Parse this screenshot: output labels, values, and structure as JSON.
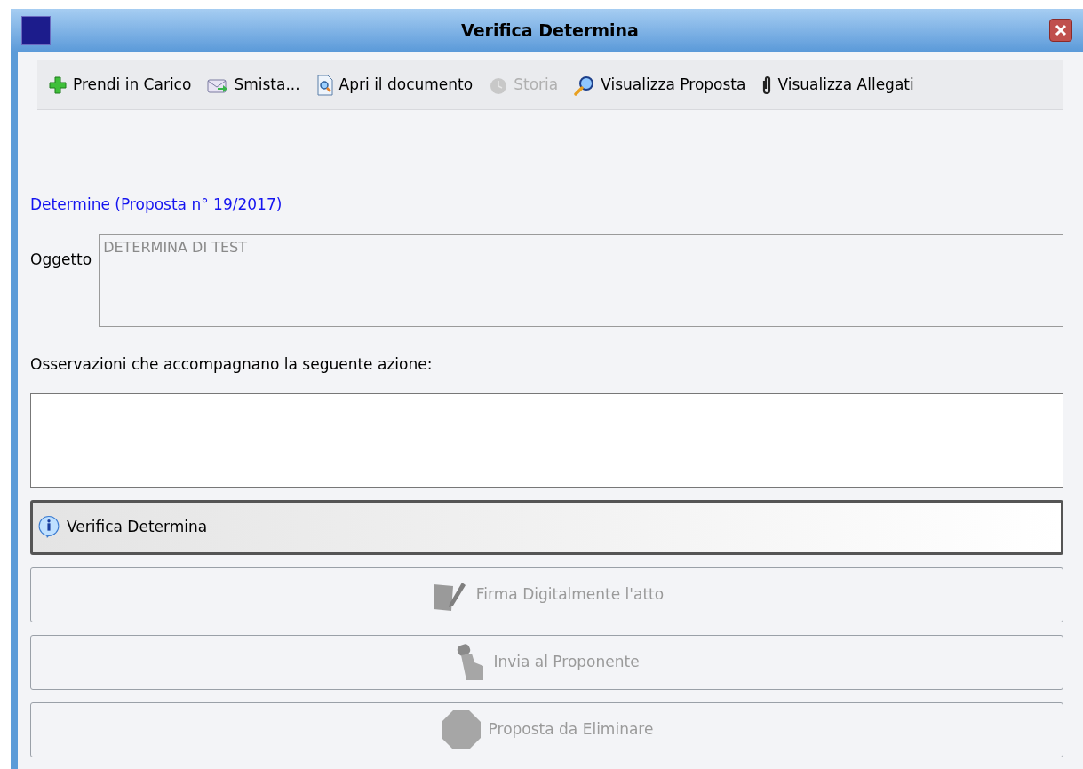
{
  "window": {
    "title": "Verifica Determina"
  },
  "toolbar": [
    {
      "kind": "plus",
      "label": "Prendi in Carico",
      "disabled": false
    },
    {
      "kind": "mail",
      "label": "Smista...",
      "disabled": false
    },
    {
      "kind": "document",
      "label": "Apri il documento",
      "disabled": false
    },
    {
      "kind": "history",
      "label": "Storia",
      "disabled": true
    },
    {
      "kind": "magnifier",
      "label": "Visualizza Proposta",
      "disabled": false
    },
    {
      "kind": "paperclip",
      "label": "Visualizza Allegati",
      "disabled": false
    }
  ],
  "heading": "Determine (Proposta n° 19/2017)",
  "subject": {
    "label": "Oggetto",
    "value": "DETERMINA DI TEST",
    "disabled": true
  },
  "notes": {
    "label": "Osservazioni che accompagnano la seguente azione:"
  },
  "actions": [
    {
      "kind": "info",
      "label": "Verifica Determina",
      "disabled": false,
      "focused": true
    },
    {
      "kind": "sign",
      "label": "Firma Digitalmente l'atto",
      "disabled": true,
      "focused": false
    },
    {
      "kind": "send",
      "label": "Invia al Proponente",
      "disabled": true,
      "focused": false
    },
    {
      "kind": "stop",
      "label": "Proposta da Eliminare",
      "disabled": true,
      "focused": false
    }
  ]
}
